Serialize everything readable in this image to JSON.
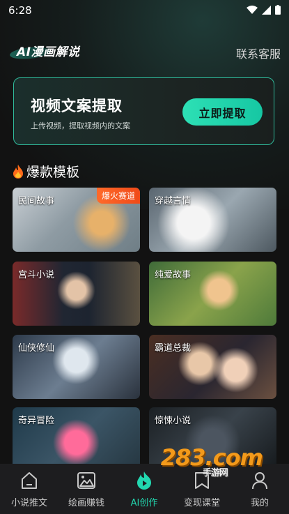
{
  "status": {
    "time": "6:28"
  },
  "header": {
    "logo_text": "AI漫画解说",
    "contact_label": "联系客服"
  },
  "extract_card": {
    "title": "视频文案提取",
    "subtitle": "上传视频，提取视频内的文案",
    "button_label": "立即提取"
  },
  "section": {
    "icon": "fire-icon",
    "title": "爆款模板"
  },
  "templates": [
    {
      "label": "民间故事",
      "badge": "爆火赛道"
    },
    {
      "label": "穿越言情"
    },
    {
      "label": "宫斗小说"
    },
    {
      "label": "纯爱故事"
    },
    {
      "label": "仙侠修仙"
    },
    {
      "label": "霸道总裁"
    },
    {
      "label": "奇异冒险"
    },
    {
      "label": "惊悚小说"
    }
  ],
  "nav": [
    {
      "label": "小说推文",
      "icon": "home-icon"
    },
    {
      "label": "绘画赚钱",
      "icon": "image-icon"
    },
    {
      "label": "AI创作",
      "icon": "ai-create-icon",
      "active": true
    },
    {
      "label": "变现课堂",
      "icon": "bookmark-icon"
    },
    {
      "label": "我的",
      "icon": "user-icon"
    }
  ],
  "watermark": {
    "text": "283",
    "suffix": ".com",
    "sub": "手游网"
  },
  "colors": {
    "accent": "#22d8b0",
    "badge": "#f04a18",
    "card_border": "#2fb99a"
  }
}
